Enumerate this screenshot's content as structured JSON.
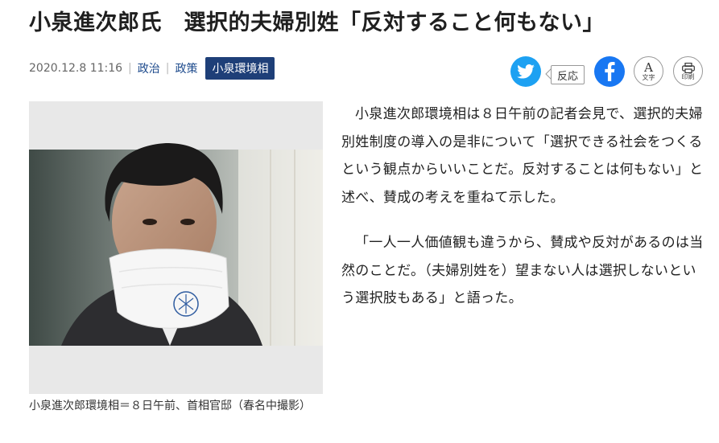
{
  "article": {
    "headline": "小泉進次郎氏　選択的夫婦別姓「反対すること何もない」",
    "datetime": "2020.12.8 11:16",
    "categories": [
      "政治",
      "政策"
    ],
    "tag": "小泉環境相",
    "paragraphs": [
      "小泉進次郎環境相は８日午前の記者会見で、選択的夫婦別姓制度の導入の是非について「選択できる社会をつくるという観点からいいことだ。反対することは何もない」と述べ、賛成の考えを重ねて示した。",
      "「一人一人価値観も違うから、賛成や反対があるのは当然のことだ。（夫婦別姓を）望まない人は選択しないという選択肢もある」と語った。"
    ]
  },
  "photo": {
    "caption": "小泉進次郎環境相＝８日午前、首相官邸（春名中撮影）"
  },
  "share": {
    "reaction_label": "反応",
    "font_size_glyph": "A",
    "font_size_label": "文字",
    "print_label": "印刷",
    "twitter_color": "#1da1f2",
    "facebook_color": "#1877f2"
  },
  "colors": {
    "tag_bg": "#1e3f78",
    "link": "#1d4a8c"
  }
}
